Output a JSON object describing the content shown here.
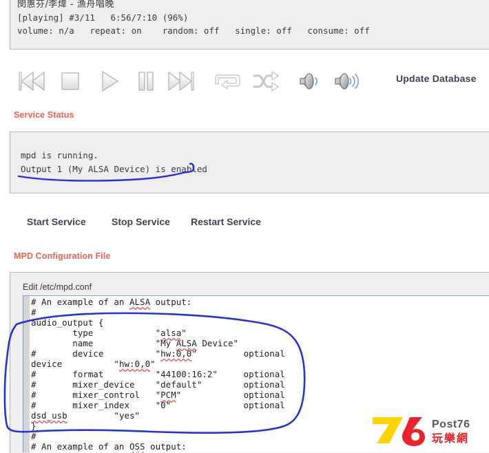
{
  "player": {
    "track_title": "閔惠芬/李煒 - 漁舟唱晚",
    "state_line": "[playing] #3/11   6:56/7:10 (96%)",
    "flags_line": "volume: n/a   repeat: on    random: off   single: off   consume: off",
    "state": "playing",
    "track_index": "#3/11",
    "elapsed": "6:56",
    "duration": "7:10",
    "percent": "96%",
    "volume": "n/a",
    "repeat": "on",
    "random": "off",
    "single": "off",
    "consume": "off"
  },
  "controls": {
    "previous": "previous-icon",
    "stop": "stop-icon",
    "play": "play-icon",
    "pause": "pause-icon",
    "next": "next-icon",
    "repeat": "repeat-icon",
    "shuffle": "shuffle-icon",
    "volume_down": "volume-down-icon",
    "volume_up": "volume-up-icon",
    "update_database_label": "Update Database"
  },
  "service_status": {
    "heading": "Service Status",
    "lines": [
      "mpd is running.",
      "Output 1 (My ALSA Device) is enabled"
    ],
    "buttons": {
      "start": "Start Service",
      "stop": "Stop Service",
      "restart": "Restart Service"
    }
  },
  "mpd_config": {
    "heading": "MPD Configuration File",
    "edit_label": "Edit /etc/mpd.conf",
    "lines": [
      "# An example of an ALSA output:",
      "#",
      "audio_output {",
      "        type            \"alsa\"",
      "        name            \"My ALSA Device\"",
      "#       device          \"hw:0,0\"         optional",
      "device          \"hw:0,0\"",
      "#       format          \"44100:16:2\"     optional",
      "#       mixer_device    \"default\"        optional",
      "#       mixer_control   \"PCM\"            optional",
      "#       mixer_index     \"0\"              optional",
      "dsd_usb         \"yes\"",
      "}",
      "#",
      "# An example of an OSS output:"
    ]
  },
  "watermark": {
    "digits": "76",
    "brand": "Post76",
    "brand_cn": "玩樂網"
  },
  "colors": {
    "heading": "#f4604f",
    "panel_bg": "#eeeeee",
    "panel_border": "#b5b5b5",
    "ink": "#2233dd",
    "textarea_border": "#7da2d0",
    "button_text": "#3d4450",
    "wm_yellow": "#ffd400",
    "wm_red": "#e8232a",
    "wm_gray": "#58585a"
  }
}
